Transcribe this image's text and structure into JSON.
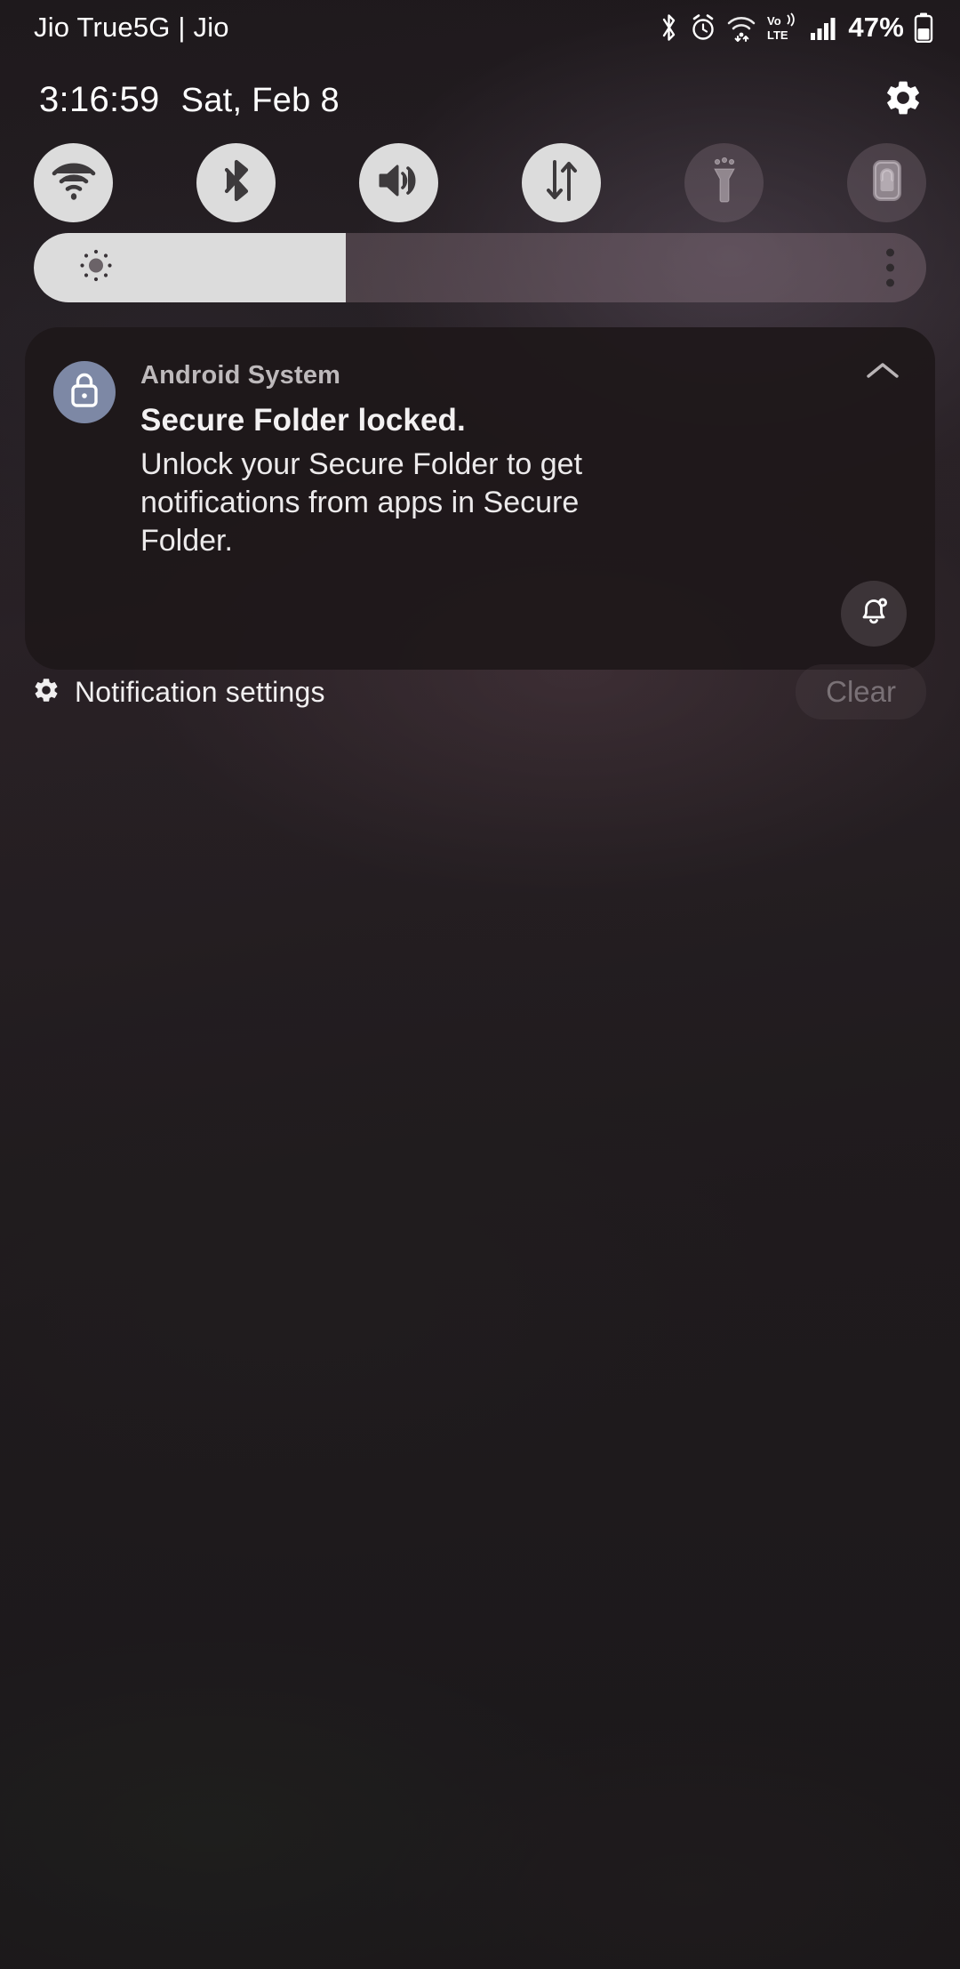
{
  "statusbar": {
    "carrier": "Jio True5G | Jio",
    "battery_percent": "47%",
    "icons": [
      "bluetooth-icon",
      "alarm-icon",
      "wifi-icon",
      "volte-icon",
      "signal-icon",
      "battery-icon"
    ],
    "network_label": "Vo)",
    "network_sub": "LTE"
  },
  "header": {
    "time": "3:16:59",
    "date": "Sat, Feb 8",
    "settings_icon": "gear-icon"
  },
  "quick_settings": {
    "toggles": [
      {
        "name": "wifi",
        "icon": "wifi-icon",
        "state": "on"
      },
      {
        "name": "bluetooth",
        "icon": "bluetooth-icon",
        "state": "on"
      },
      {
        "name": "sound",
        "icon": "sound-icon",
        "state": "on"
      },
      {
        "name": "mobile-data",
        "icon": "data-arrows-icon",
        "state": "on"
      },
      {
        "name": "flashlight",
        "icon": "flashlight-icon",
        "state": "off"
      },
      {
        "name": "lock",
        "icon": "lock-icon",
        "state": "off"
      }
    ],
    "brightness": {
      "name": "brightness-slider",
      "level_percent": 35,
      "sun_icon": "sun-icon",
      "more_icon": "more-vertical-icon"
    }
  },
  "notification": {
    "app_name": "Android System",
    "app_icon": "lock-icon",
    "title": "Secure Folder locked.",
    "text": "Unlock your Secure Folder to get notifications from apps in Secure Folder.",
    "collapse_icon": "chevron-up-icon",
    "action_icon": "bell-settings-icon"
  },
  "footer": {
    "settings_icon": "gear-icon",
    "settings_label": "Notification settings",
    "clear_label": "Clear"
  },
  "colors": {
    "toggle_on_bg": "#dcdcdc",
    "toggle_on_fg": "#3d3a3c",
    "app_icon_bg": "#7d88a5",
    "card_bg": "#1e181a",
    "text_primary": "#f3f1f2",
    "text_secondary": "#bdb9bb"
  }
}
